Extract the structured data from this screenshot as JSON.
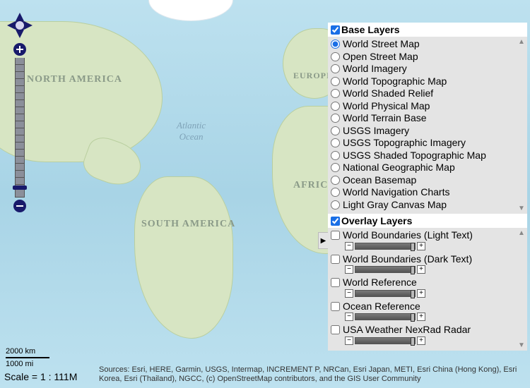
{
  "map": {
    "continents": {
      "north_america": "NORTH AMERICA",
      "south_america": "SOUTH AMERICA",
      "europe": "EUROPI",
      "africa": "AFRICA"
    },
    "ocean_label_1": "Atlantic",
    "ocean_label_2": "Ocean"
  },
  "scale": {
    "km": "2000 km",
    "mi": "1000 mi",
    "ratio": "Scale = 1 : 111M"
  },
  "attribution": "Sources: Esri, HERE, Garmin, USGS, Intermap, INCREMENT P, NRCan, Esri Japan, METI, Esri China (Hong Kong), Esri Korea, Esri (Thailand), NGCC, (c) OpenStreetMap contributors, and the GIS User Community",
  "panel": {
    "base_header": "Base Layers",
    "overlay_header": "Overlay Layers",
    "base_layers": [
      "World Street Map",
      "Open Street Map",
      "World Imagery",
      "World Topographic Map",
      "World Shaded Relief",
      "World Physical Map",
      "World Terrain Base",
      "USGS Imagery",
      "USGS Topographic Imagery",
      "USGS Shaded Topographic Map",
      "National Geographic Map",
      "Ocean Basemap",
      "World Navigation Charts",
      "Light Gray Canvas Map"
    ],
    "base_selected": 0,
    "overlay_layers": [
      "World Boundaries (Light Text)",
      "World Boundaries (Dark Text)",
      "World Reference",
      "Ocean Reference",
      "USA Weather NexRad Radar"
    ]
  },
  "glyphs": {
    "minus": "−",
    "plus": "+",
    "tri_up": "▲",
    "tri_down": "▼",
    "tri_right": "▶"
  }
}
